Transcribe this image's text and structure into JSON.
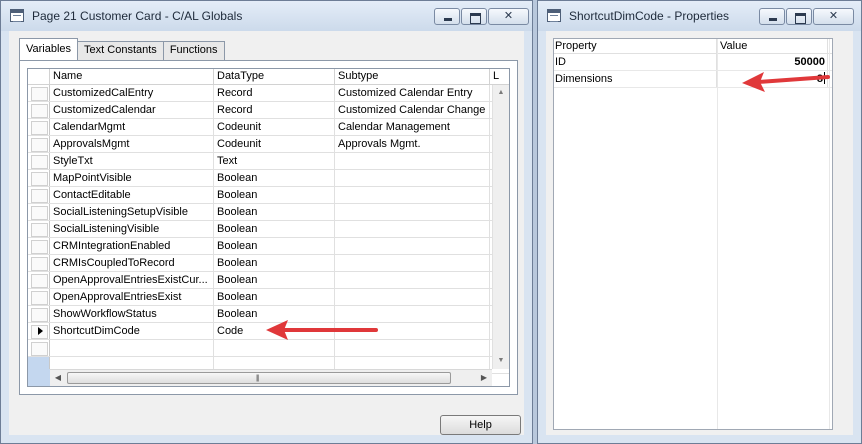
{
  "left_window": {
    "title": "Page 21 Customer Card - C/AL Globals",
    "tabs": [
      {
        "label": "Variables",
        "active": true
      },
      {
        "label": "Text Constants",
        "active": false
      },
      {
        "label": "Functions",
        "active": false
      }
    ],
    "columns": {
      "name": "Name",
      "datatype": "DataType",
      "subtype": "Subtype",
      "length": "L"
    },
    "rows": [
      {
        "name": "CustomizedCalEntry",
        "datatype": "Record",
        "subtype": "Customized Calendar Entry"
      },
      {
        "name": "CustomizedCalendar",
        "datatype": "Record",
        "subtype": "Customized Calendar Change"
      },
      {
        "name": "CalendarMgmt",
        "datatype": "Codeunit",
        "subtype": "Calendar Management"
      },
      {
        "name": "ApprovalsMgmt",
        "datatype": "Codeunit",
        "subtype": "Approvals Mgmt."
      },
      {
        "name": "StyleTxt",
        "datatype": "Text",
        "subtype": ""
      },
      {
        "name": "MapPointVisible",
        "datatype": "Boolean",
        "subtype": ""
      },
      {
        "name": "ContactEditable",
        "datatype": "Boolean",
        "subtype": ""
      },
      {
        "name": "SocialListeningSetupVisible",
        "datatype": "Boolean",
        "subtype": ""
      },
      {
        "name": "SocialListeningVisible",
        "datatype": "Boolean",
        "subtype": ""
      },
      {
        "name": "CRMIntegrationEnabled",
        "datatype": "Boolean",
        "subtype": ""
      },
      {
        "name": "CRMIsCoupledToRecord",
        "datatype": "Boolean",
        "subtype": ""
      },
      {
        "name": "OpenApprovalEntriesExistCur...",
        "datatype": "Boolean",
        "subtype": ""
      },
      {
        "name": "OpenApprovalEntriesExist",
        "datatype": "Boolean",
        "subtype": ""
      },
      {
        "name": "ShowWorkflowStatus",
        "datatype": "Boolean",
        "subtype": ""
      },
      {
        "name": "ShortcutDimCode",
        "datatype": "Code",
        "subtype": "",
        "current": true
      }
    ],
    "help_label": "Help"
  },
  "right_window": {
    "title": "ShortcutDimCode - Properties",
    "columns": {
      "property": "Property",
      "value": "Value"
    },
    "rows": [
      {
        "property": "ID",
        "value": "50000"
      },
      {
        "property": "Dimensions",
        "value": "8"
      }
    ]
  },
  "colors": {
    "annotation_arrow": "#e0383a",
    "title_bar": "#d9e4f1"
  }
}
